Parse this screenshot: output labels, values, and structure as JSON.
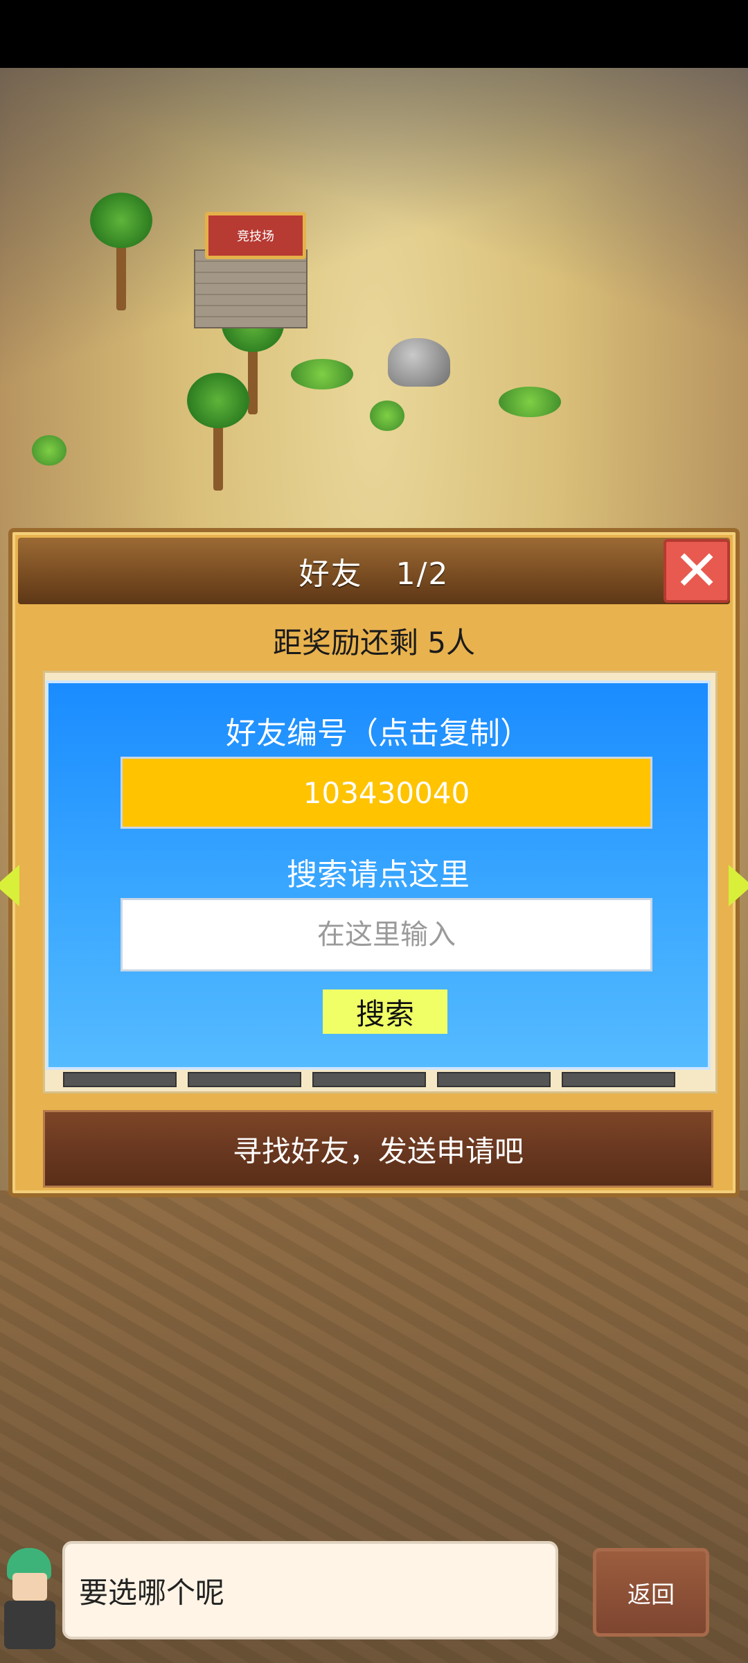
{
  "scene": {
    "arena_sign": "竞技场"
  },
  "dialog": {
    "title": "好友",
    "page_indicator": "1/2",
    "close_icon": "close-icon",
    "reward_text": "距奖励还剩 5人",
    "id_panel": {
      "label": "好友编号（点击复制）",
      "friend_id": "103430040",
      "search_label": "搜索请点这里",
      "search_placeholder": "在这里输入",
      "search_button": "搜索"
    },
    "find_button": "寻找好友，发送申请吧"
  },
  "bottom": {
    "message": "要选哪个呢",
    "back_button": "返回"
  },
  "colors": {
    "dialog_bg": "#e8b24e",
    "id_panel_bg": "#1a8cff",
    "friend_id_box": "#ffc300",
    "search_button": "#f0ff66",
    "close_button": "#e85a4f",
    "find_button": "#6a3820"
  }
}
